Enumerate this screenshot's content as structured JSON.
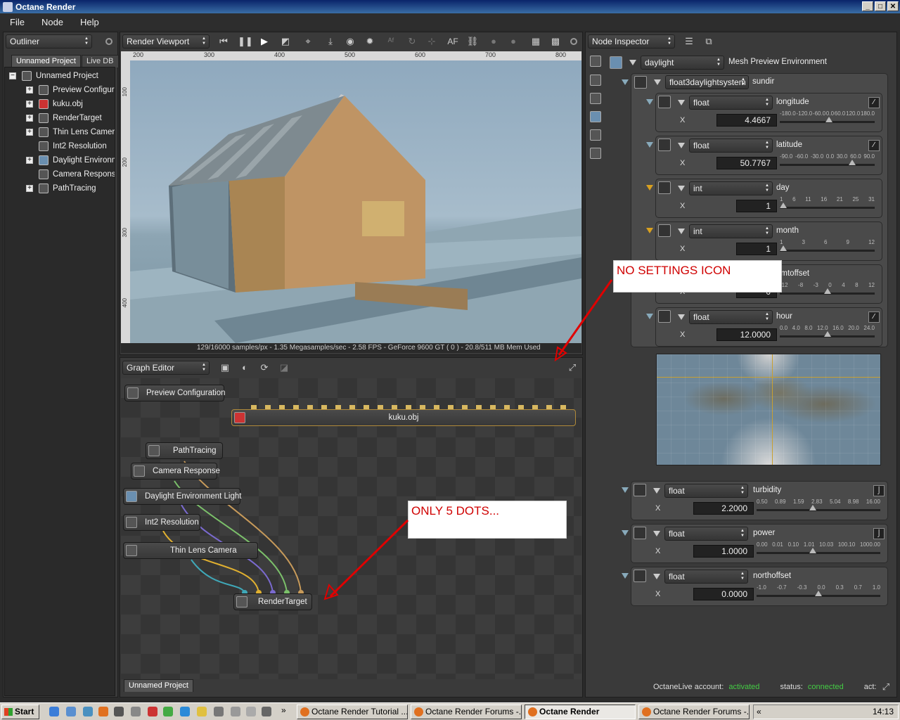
{
  "window": {
    "title": "Octane Render"
  },
  "menu": [
    "File",
    "Node",
    "Help"
  ],
  "outliner": {
    "combo": "Outliner",
    "tabs": [
      "Unnamed Project",
      "Live DB"
    ],
    "root": "Unnamed Project",
    "items": [
      {
        "label": "Preview Configurati",
        "expandable": true
      },
      {
        "label": "kuku.obj",
        "expandable": true
      },
      {
        "label": "RenderTarget",
        "expandable": true
      },
      {
        "label": "Thin Lens Camera",
        "expandable": true
      },
      {
        "label": "Int2 Resolution",
        "expandable": false
      },
      {
        "label": "Daylight Environme",
        "expandable": true
      },
      {
        "label": "Camera Response",
        "expandable": false
      },
      {
        "label": "PathTracing",
        "expandable": true
      }
    ]
  },
  "viewport": {
    "combo": "Render Viewport",
    "af_label": "AF",
    "ruler_h": [
      "200",
      "300",
      "400",
      "500",
      "600",
      "700",
      "800"
    ],
    "ruler_v": [
      "100",
      "200",
      "300",
      "400"
    ],
    "status": "129/16000 samples/px - 1.35 Megasamples/sec - 2.58 FPS - GeForce 9600 GT ( 0 ) - 20.8/511 MB Mem Used"
  },
  "graph_editor": {
    "combo": "Graph Editor",
    "tab": "Unnamed Project",
    "nodes": {
      "preview": "Preview Configuration",
      "kuku": "kuku.obj",
      "pathtracing": "PathTracing",
      "camresp": "Camera Response",
      "daylight": "Daylight Environment Light",
      "int2": "Int2 Resolution",
      "thinlens": "Thin Lens Camera",
      "rendertarget": "RenderTarget"
    }
  },
  "inspector": {
    "combo": "Node Inspector",
    "root": {
      "type": "daylight",
      "name": "Mesh Preview Environment"
    },
    "system": {
      "type": "float3daylightsystem",
      "name": "sundir"
    },
    "params": [
      {
        "type": "float",
        "name": "longitude",
        "x": "4.4667",
        "scale": [
          "-180.0",
          "-120.0",
          "-60.0",
          "0.0",
          "60.0",
          "120.0",
          "180.0"
        ],
        "pos": 0.52
      },
      {
        "type": "float",
        "name": "latitude",
        "x": "50.7767",
        "scale": [
          "-90.0",
          "-60.0",
          "-30.0",
          "0.0",
          "30.0",
          "60.0",
          "90.0"
        ],
        "pos": 0.78
      },
      {
        "type": "int",
        "name": "day",
        "x": "1",
        "scale": [
          "1",
          "6",
          "11",
          "16",
          "21",
          "25",
          "31"
        ],
        "pos": 0.0
      },
      {
        "type": "int",
        "name": "month",
        "x": "1",
        "scale": [
          "1",
          "3",
          "6",
          "9",
          "12"
        ],
        "pos": 0.0
      },
      {
        "type": "int",
        "name": "gmtoffset",
        "x": "0",
        "scale": [
          "-12",
          "-8",
          "-3",
          "0",
          "4",
          "8",
          "12"
        ],
        "pos": 0.5
      },
      {
        "type": "float",
        "name": "hour",
        "x": "12.0000",
        "scale": [
          "0.0",
          "4.0",
          "8.0",
          "12.0",
          "16.0",
          "20.0",
          "24.0"
        ],
        "pos": 0.5
      }
    ],
    "outer_params": [
      {
        "type": "float",
        "name": "turbidity",
        "x": "2.2000",
        "scale": [
          "0.50",
          "0.89",
          "1.59",
          "2.83",
          "5.04",
          "8.98",
          "16.00"
        ],
        "pos": 0.45
      },
      {
        "type": "float",
        "name": "power",
        "x": "1.0000",
        "scale": [
          "0.00",
          "0.01",
          "0.10",
          "1.01",
          "10.03",
          "100.10",
          "1000.00"
        ],
        "pos": 0.45
      },
      {
        "type": "float",
        "name": "northoffset",
        "x": "0.0000",
        "scale": [
          "-1.0",
          "-0.7",
          "-0.3",
          "0.0",
          "0.3",
          "0.7",
          "1.0"
        ],
        "pos": 0.5
      }
    ],
    "x_label": "X",
    "footer": {
      "account_label": "OctaneLive account:",
      "account_value": "activated",
      "status_label": "status:",
      "status_value": "connected",
      "act_label": "act:"
    }
  },
  "annotations": {
    "settings": "NO SETTINGS ICON",
    "dots": "ONLY 5 DOTS..."
  },
  "taskbar": {
    "start": "Start",
    "items": [
      "Octane Render Tutorial ...",
      "Octane Render Forums -...",
      "Octane Render",
      "Octane Render Forums -..."
    ],
    "clock": "14:13"
  }
}
